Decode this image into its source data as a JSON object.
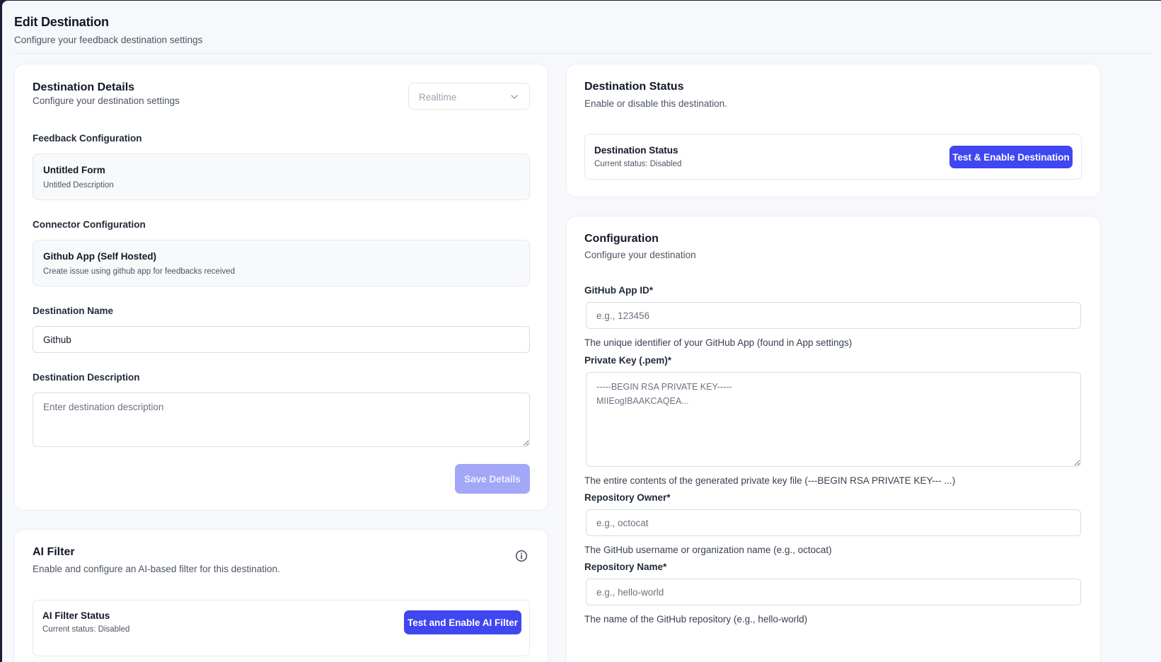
{
  "page": {
    "title": "Edit Destination",
    "subtitle": "Configure your feedback destination settings"
  },
  "details": {
    "title": "Destination Details",
    "subtitle": "Configure your destination settings",
    "mode_select": {
      "value": "Realtime"
    },
    "feedback_label": "Feedback Configuration",
    "feedback": {
      "title": "Untitled Form",
      "desc": "Untitled Description"
    },
    "connector_label": "Connector Configuration",
    "connector": {
      "title": "Github App (Self Hosted)",
      "desc": "Create issue using github app for feedbacks received"
    },
    "name_label": "Destination Name",
    "name_value": "Github",
    "desc_label": "Destination Description",
    "desc_placeholder": "Enter destination description",
    "save_label": "Save Details"
  },
  "ai_filter": {
    "title": "AI Filter",
    "subtitle": "Enable and configure an AI-based filter for this destination.",
    "status_title": "AI Filter Status",
    "status_desc": "Current status: Disabled",
    "button": "Test and Enable AI Filter"
  },
  "status": {
    "title": "Destination Status",
    "subtitle": "Enable or disable this destination.",
    "box_title": "Destination Status",
    "box_desc": "Current status: Disabled",
    "button": "Test & Enable Destination"
  },
  "config": {
    "title": "Configuration",
    "subtitle": "Configure your destination",
    "app_id": {
      "label": "GitHub App ID*",
      "placeholder": "e.g., 123456",
      "help": "The unique identifier of your GitHub App (found in App settings)"
    },
    "private_key": {
      "label": "Private Key (.pem)*",
      "placeholder": "-----BEGIN RSA PRIVATE KEY-----\nMIIEogIBAAKCAQEA...",
      "help": "The entire contents of the generated private key file (---BEGIN RSA PRIVATE KEY--- ...)"
    },
    "repo_owner": {
      "label": "Repository Owner*",
      "placeholder": "e.g., octocat",
      "help": "The GitHub username or organization name (e.g., octocat)"
    },
    "repo_name": {
      "label": "Repository Name*",
      "placeholder": "e.g., hello-world",
      "help": "The name of the GitHub repository (e.g., hello-world)"
    }
  },
  "colors": {
    "primary": "#4046f0",
    "primary_disabled": "#a3a7f7",
    "background": "#f7f8fb"
  }
}
